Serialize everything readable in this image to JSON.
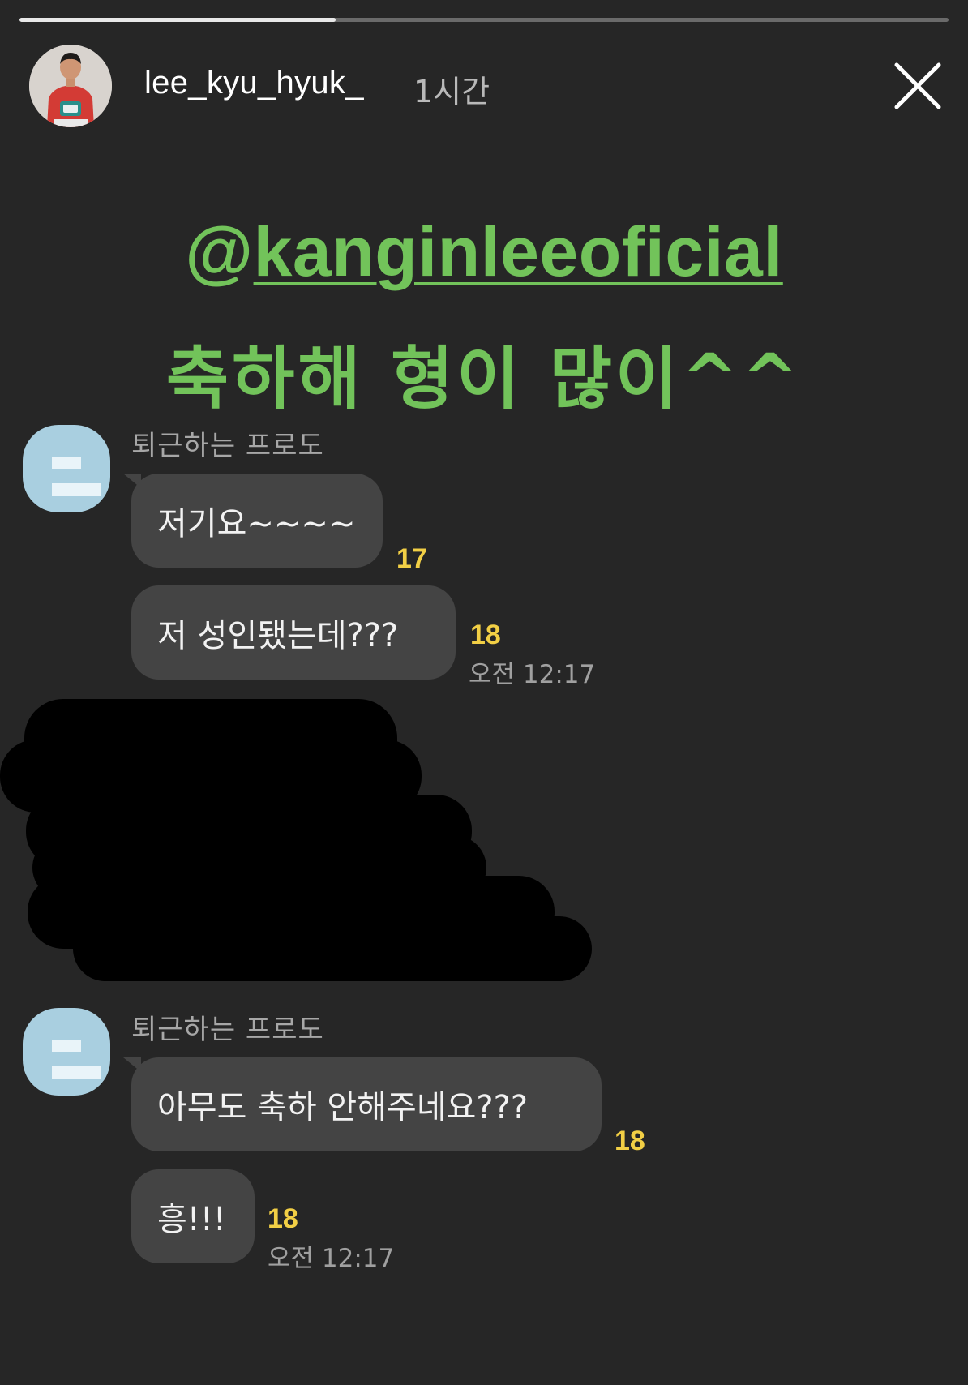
{
  "story": {
    "progress_percent": 34,
    "username": "lee_kyu_hyuk_",
    "time_ago": "1시간",
    "close_icon": "close-icon"
  },
  "caption": {
    "at": "@",
    "mention_handle": "kanginleeoficial",
    "text": "축하해 형이 많이^^",
    "color": "#72c35a"
  },
  "chat": {
    "groups": [
      {
        "sender": "퇴근하는 프로도",
        "messages": [
          {
            "text": "저기요~~~~",
            "unread": "17"
          },
          {
            "text": "저 성인됐는데???",
            "unread": "18",
            "time": "오전 12:17"
          }
        ]
      },
      {
        "sender": "퇴근하는 프로도",
        "messages": [
          {
            "text": "아무도 축하 안해주네요???",
            "unread": "18"
          },
          {
            "text": "흥!!!",
            "unread": "18",
            "time": "오전 12:17"
          }
        ]
      }
    ],
    "colors": {
      "bubble": "#444444",
      "unread": "#f2cf45",
      "avatar": "#a9cfe0",
      "background": "#262626"
    }
  }
}
